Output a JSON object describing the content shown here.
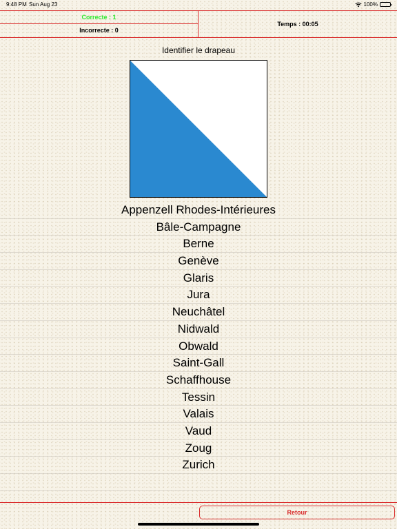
{
  "status_bar": {
    "time": "9:48 PM",
    "date": "Sun Aug 23",
    "battery": "100%"
  },
  "score": {
    "correct": "Correcte : 1",
    "incorrect": "Incorrecte : 0",
    "timer": "Temps : 00:05"
  },
  "prompt": "Identifier le drapeau",
  "flag": {
    "colors": {
      "blue": "#2a89d0",
      "white": "#ffffff"
    },
    "icon": "zurich-flag"
  },
  "answers": [
    "Appenzell Rhodes-Intérieures",
    "Bâle-Campagne",
    "Berne",
    "Genève",
    "Glaris",
    "Jura",
    "Neuchâtel",
    "Nidwald",
    "Obwald",
    "Saint-Gall",
    "Schaffhouse",
    "Tessin",
    "Valais",
    "Vaud",
    "Zoug",
    "Zurich"
  ],
  "footer": {
    "back_label": "Retour"
  },
  "colors": {
    "accent": "#d92b2b",
    "correct": "#2ee82e"
  }
}
